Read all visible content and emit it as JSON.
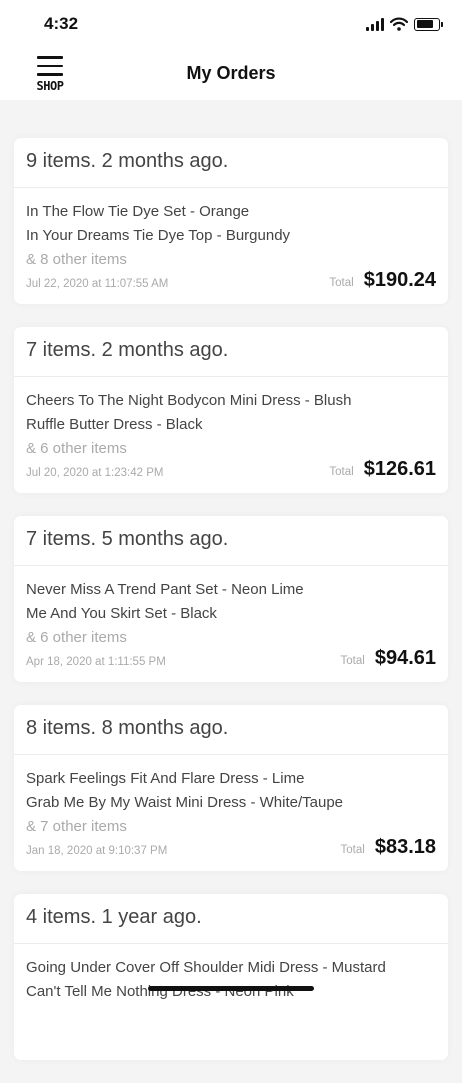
{
  "status": {
    "time": "4:32",
    "battery_level": 0.8
  },
  "header": {
    "menu_label": "SHOP",
    "title": "My Orders"
  },
  "labels": {
    "total": "Total"
  },
  "orders": [
    {
      "summary": "9 items. 2 months ago.",
      "items": [
        "In The Flow Tie Dye Set - Orange",
        "In Your Dreams Tie Dye Top - Burgundy"
      ],
      "more": "& 8 other items",
      "date": "Jul 22, 2020 at 11:07:55 AM",
      "total": "$190.24"
    },
    {
      "summary": "7 items. 2 months ago.",
      "items": [
        "Cheers To The Night Bodycon Mini Dress - Blush",
        "Ruffle Butter Dress - Black"
      ],
      "more": "& 6 other items",
      "date": "Jul 20, 2020 at 1:23:42 PM",
      "total": "$126.61"
    },
    {
      "summary": "7 items. 5 months ago.",
      "items": [
        "Never Miss A Trend Pant Set - Neon Lime",
        "Me And You Skirt Set - Black"
      ],
      "more": "& 6 other items",
      "date": "Apr 18, 2020 at 1:11:55 PM",
      "total": "$94.61"
    },
    {
      "summary": "8 items. 8 months ago.",
      "items": [
        "Spark Feelings Fit And Flare Dress - Lime",
        "Grab Me By My Waist Mini Dress - White/Taupe"
      ],
      "more": "& 7 other items",
      "date": "Jan 18, 2020 at 9:10:37 PM",
      "total": "$83.18"
    },
    {
      "summary": "4 items. 1 year ago.",
      "items": [
        "Going Under Cover Off Shoulder Midi Dress - Mustard",
        "Can't Tell Me Nothing Dress - Neon Pink"
      ],
      "more": "",
      "date": "",
      "total": ""
    }
  ]
}
